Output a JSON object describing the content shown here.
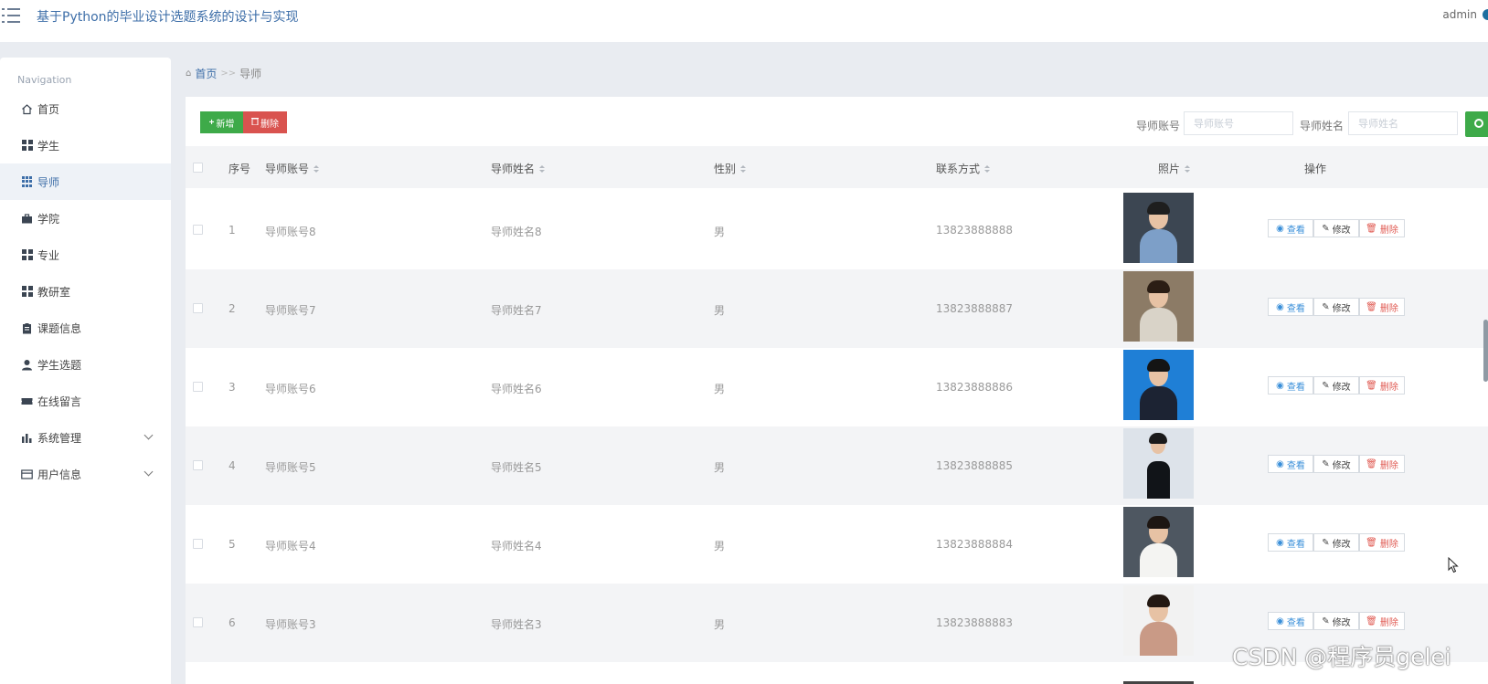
{
  "header": {
    "title": "基于Python的毕业设计选题系统的设计与实现",
    "user": "admin"
  },
  "sidebar": {
    "heading": "Navigation",
    "items": [
      {
        "label": "首页",
        "icon": "home-icon"
      },
      {
        "label": "学生",
        "icon": "grid-icon"
      },
      {
        "label": "导师",
        "icon": "grid-small-icon",
        "active": true
      },
      {
        "label": "学院",
        "icon": "briefcase-icon"
      },
      {
        "label": "专业",
        "icon": "grid-icon"
      },
      {
        "label": "教研室",
        "icon": "grid-icon"
      },
      {
        "label": "课题信息",
        "icon": "clipboard-icon"
      },
      {
        "label": "学生选题",
        "icon": "user-icon"
      },
      {
        "label": "在线留言",
        "icon": "ticket-icon"
      },
      {
        "label": "系统管理",
        "icon": "bar-chart-icon",
        "expandable": true
      },
      {
        "label": "用户信息",
        "icon": "card-icon",
        "expandable": true
      }
    ]
  },
  "breadcrumb": {
    "home": "首页",
    "separator": ">>",
    "current": "导师"
  },
  "toolbar": {
    "add_label": "新增",
    "delete_label": "删除",
    "search_account_label": "导师账号",
    "search_account_placeholder": "导师账号",
    "search_name_label": "导师姓名",
    "search_name_placeholder": "导师姓名"
  },
  "table": {
    "columns": [
      "序号",
      "导师账号",
      "导师姓名",
      "性别",
      "联系方式",
      "照片",
      "操作"
    ],
    "actions": {
      "view": "查看",
      "edit": "修改",
      "delete": "删除"
    },
    "rows": [
      {
        "no": "1",
        "account": "导师账号8",
        "name": "导师姓名8",
        "gender": "男",
        "phone": "13823888888"
      },
      {
        "no": "2",
        "account": "导师账号7",
        "name": "导师姓名7",
        "gender": "男",
        "phone": "13823888887"
      },
      {
        "no": "3",
        "account": "导师账号6",
        "name": "导师姓名6",
        "gender": "男",
        "phone": "13823888886"
      },
      {
        "no": "4",
        "account": "导师账号5",
        "name": "导师姓名5",
        "gender": "男",
        "phone": "13823888885"
      },
      {
        "no": "5",
        "account": "导师账号4",
        "name": "导师姓名4",
        "gender": "男",
        "phone": "13823888884"
      },
      {
        "no": "6",
        "account": "导师账号3",
        "name": "导师姓名3",
        "gender": "男",
        "phone": "13823888883"
      }
    ]
  },
  "watermark": "CSDN @程序员gelei",
  "colors": {
    "accent": "#3d6ea8",
    "add_button": "#3eaa49",
    "delete_button": "#d9534f",
    "view_link": "#3a8fd9"
  }
}
